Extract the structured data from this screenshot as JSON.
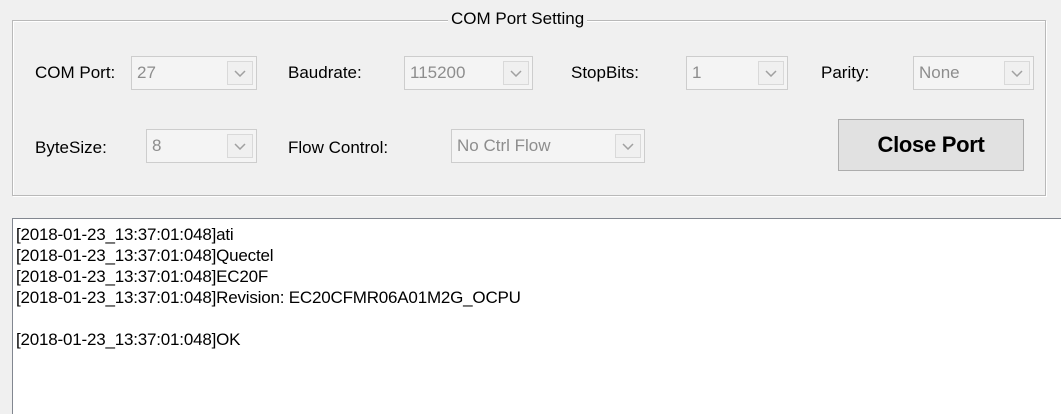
{
  "group": {
    "title": "COM Port Setting"
  },
  "settings": {
    "com_port_label": "COM Port:",
    "com_port_value": "27",
    "baudrate_label": "Baudrate:",
    "baudrate_value": "115200",
    "stopbits_label": "StopBits:",
    "stopbits_value": "1",
    "parity_label": "Parity:",
    "parity_value": "None",
    "bytesize_label": "ByteSize:",
    "bytesize_value": "8",
    "flow_label": "Flow Control:",
    "flow_value": "No Ctrl Flow"
  },
  "buttons": {
    "close_port": "Close Port"
  },
  "log": {
    "lines": [
      "[2018-01-23_13:37:01:048]ati",
      "[2018-01-23_13:37:01:048]Quectel",
      "[2018-01-23_13:37:01:048]EC20F",
      "[2018-01-23_13:37:01:048]Revision: EC20CFMR06A01M2G_OCPU",
      "",
      "[2018-01-23_13:37:01:048]OK"
    ]
  }
}
